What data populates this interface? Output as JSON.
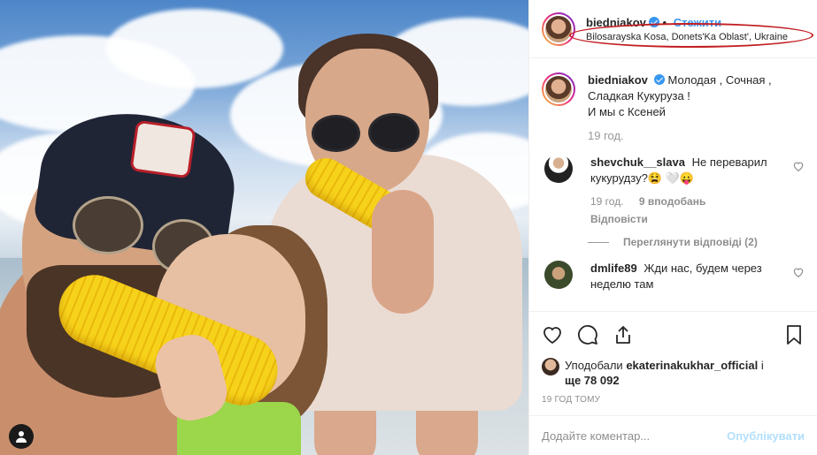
{
  "header": {
    "username": "biedniakov",
    "follow_label": "Стежити",
    "location": "Bilosarayska Kosa, Donets'Ka Oblast', Ukraine"
  },
  "caption": {
    "username": "biedniakov",
    "text_line1": "Молодая , Сочная ,",
    "text_line2": "Сладкая Кукуруза !",
    "text_line3": "И мы с Ксеней",
    "time": "19 год."
  },
  "comments": [
    {
      "username": "shevchuk__slava",
      "text": "Не переварил кукурудзу?😫 🤍😛",
      "time": "19 год.",
      "likes": "9 вподобань",
      "reply": "Відповісти",
      "view_replies": "Переглянути відповіді (2)"
    },
    {
      "username": "dmlife89",
      "text": "Жди нас, будем через неделю там"
    }
  ],
  "likes": {
    "prefix": "Уподобали",
    "user": "ekaterinakukhar_official",
    "suffix_join": "і",
    "suffix": "ще 78 092"
  },
  "posted": "19 ГОД ТОМУ",
  "add_comment": {
    "placeholder": "Додайте коментар...",
    "publish": "Опублікувати"
  },
  "colors": {
    "link": "#3897f0",
    "publish_disabled": "#b2dffc",
    "annotation": "#c21e22"
  },
  "icons": [
    "heart-icon",
    "comment-icon",
    "share-icon",
    "bookmark-icon",
    "verified-icon",
    "user-icon"
  ]
}
